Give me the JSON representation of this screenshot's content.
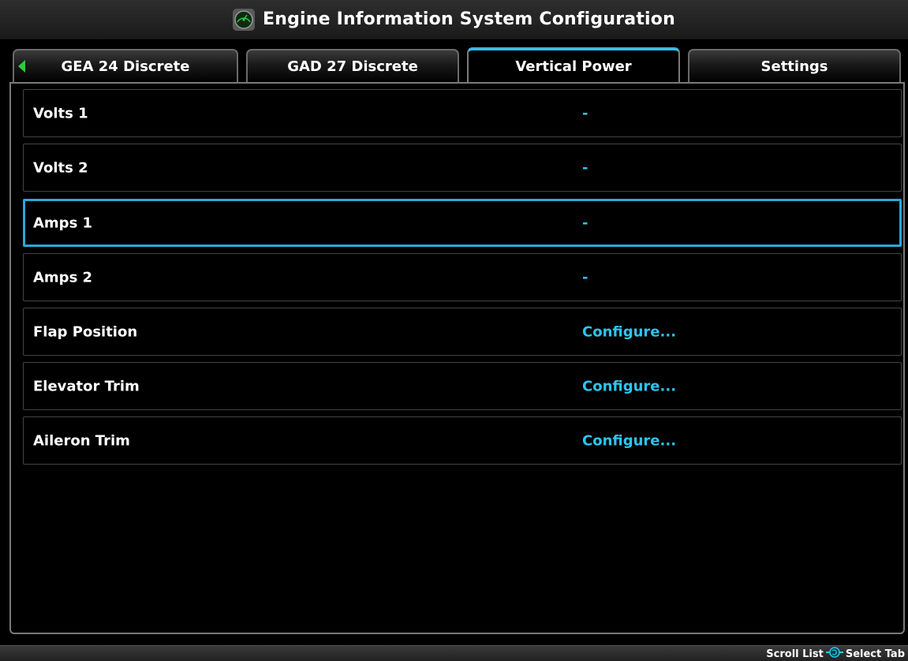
{
  "header": {
    "title": "Engine Information System Configuration",
    "icon": "gauge-icon"
  },
  "tabs": [
    {
      "label": "GEA 24 Discrete",
      "active": false
    },
    {
      "label": "GAD 27 Discrete",
      "active": false
    },
    {
      "label": "Vertical Power",
      "active": true
    },
    {
      "label": "Settings",
      "active": false
    }
  ],
  "rows": [
    {
      "label": "Volts 1",
      "value": "-"
    },
    {
      "label": "Volts 2",
      "value": "-"
    },
    {
      "label": "Amps 1",
      "value": "-",
      "selected": true
    },
    {
      "label": "Amps 2",
      "value": "-"
    },
    {
      "label": "Flap Position",
      "value": "Configure..."
    },
    {
      "label": "Elevator Trim",
      "value": "Configure..."
    },
    {
      "label": "Aileron Trim",
      "value": "Configure..."
    }
  ],
  "footer": {
    "scroll_label": "Scroll List",
    "select_label": "Select Tab",
    "icon": "knob-icon"
  },
  "colors": {
    "accent": "#2ec4ee",
    "selection_border": "#2aa8d8",
    "tab_arrow": "#2ec93c"
  }
}
